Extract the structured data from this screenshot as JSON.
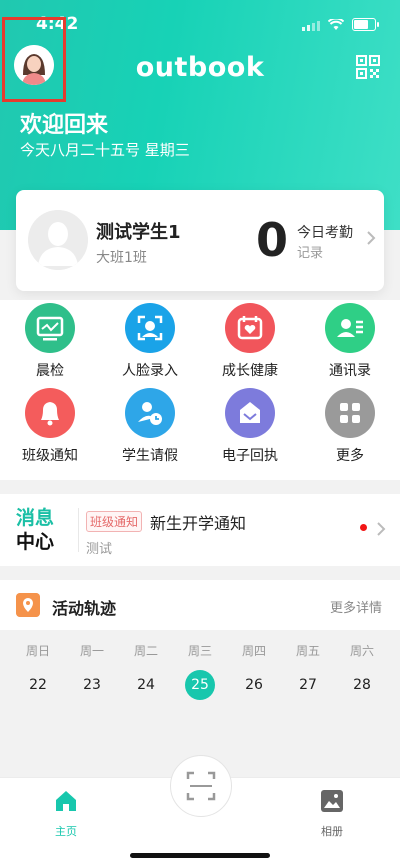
{
  "status": {
    "time": "4:42"
  },
  "header": {
    "brand": "outbook",
    "welcome": "欢迎回来",
    "date": "今天八月二十五号 星期三"
  },
  "student": {
    "name": "测试学生1",
    "class": "大班1班",
    "attendance_count": "0",
    "attendance_label": "今日考勤",
    "record_label": "记录"
  },
  "features": [
    {
      "label": "晨检",
      "color": "#2fbf8a",
      "icon": "monitor-icon"
    },
    {
      "label": "人脸录入",
      "color": "#1aa3e8",
      "icon": "face-scan-icon"
    },
    {
      "label": "成长健康",
      "color": "#f1555b",
      "icon": "calendar-heart-icon"
    },
    {
      "label": "通讯录",
      "color": "#2fcf86",
      "icon": "contacts-icon"
    },
    {
      "label": "班级通知",
      "color": "#f45c5c",
      "icon": "bell-icon"
    },
    {
      "label": "学生请假",
      "color": "#2ea6e8",
      "icon": "leave-clock-icon"
    },
    {
      "label": "电子回执",
      "color": "#7d7bdc",
      "icon": "receipt-icon"
    },
    {
      "label": "更多",
      "color": "#9a9a9a",
      "icon": "grid-icon"
    }
  ],
  "message": {
    "logo_line1": "消息",
    "logo_line2": "中心",
    "tag": "班级通知",
    "title": "新生开学通知",
    "subtitle": "测试"
  },
  "activity": {
    "title": "活动轨迹",
    "more": "更多详情",
    "weekdays": [
      "周日",
      "周一",
      "周二",
      "周三",
      "周四",
      "周五",
      "周六"
    ],
    "dates": [
      "22",
      "23",
      "24",
      "25",
      "26",
      "27",
      "28"
    ],
    "today_index": 3
  },
  "tabs": {
    "home": "主页",
    "album": "相册"
  },
  "colors": {
    "accent": "#18c7ad",
    "highlight_box": "#e63b2e"
  }
}
